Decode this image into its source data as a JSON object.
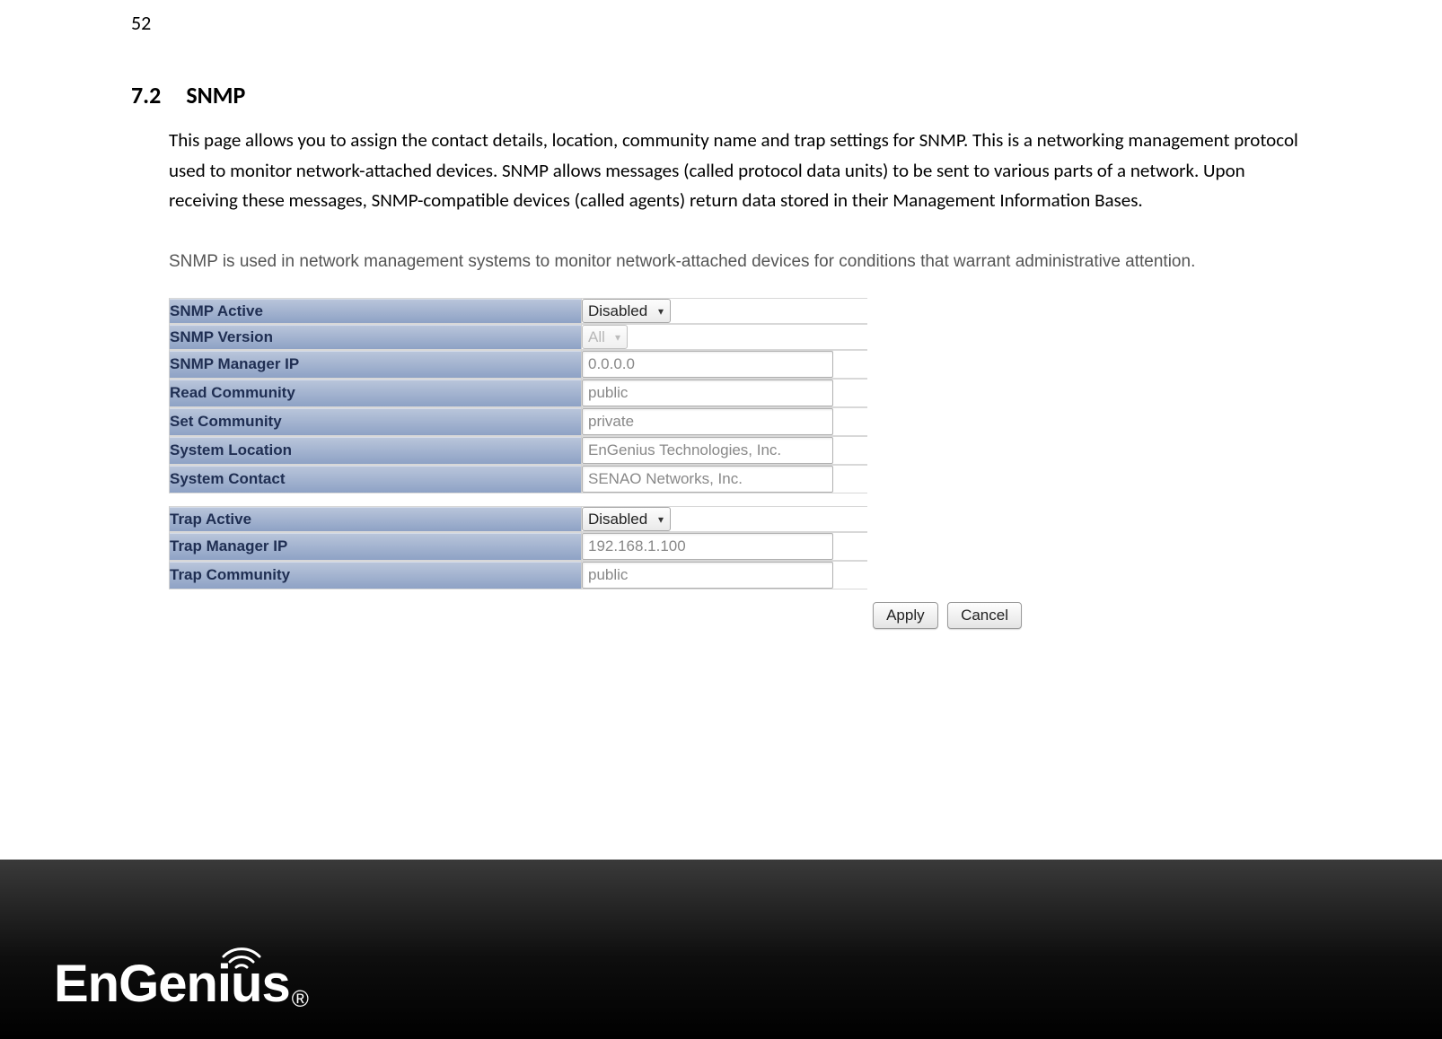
{
  "page_number": "52",
  "heading": {
    "number": "7.2",
    "title": "SNMP"
  },
  "intro": "This page allows you to assign the contact details, location, community name and trap settings for SNMP. This is a networking management protocol used to monitor network-attached devices. SNMP allows messages (called protocol data units) to be sent to various parts of a network. Upon receiving these messages, SNMP-compatible devices (called agents) return data stored in their Management Information Bases.",
  "snmp_note": "SNMP is used in network management systems to monitor network-attached devices for conditions that warrant administrative attention.",
  "fields": {
    "snmp_active": {
      "label": "SNMP Active",
      "value": "Disabled"
    },
    "snmp_version": {
      "label": "SNMP Version",
      "value": "All"
    },
    "snmp_manager_ip": {
      "label": "SNMP Manager IP",
      "value": "0.0.0.0"
    },
    "read_community": {
      "label": "Read Community",
      "value": "public"
    },
    "set_community": {
      "label": "Set Community",
      "value": "private"
    },
    "system_location": {
      "label": "System Location",
      "value": "EnGenius Technologies, Inc."
    },
    "system_contact": {
      "label": "System Contact",
      "value": "SENAO Networks, Inc."
    },
    "trap_active": {
      "label": "Trap Active",
      "value": "Disabled"
    },
    "trap_manager_ip": {
      "label": "Trap Manager IP",
      "value": "192.168.1.100"
    },
    "trap_community": {
      "label": "Trap Community",
      "value": "public"
    }
  },
  "buttons": {
    "apply": "Apply",
    "cancel": "Cancel"
  },
  "logo": {
    "text": "EnGenius",
    "reg": "®"
  }
}
